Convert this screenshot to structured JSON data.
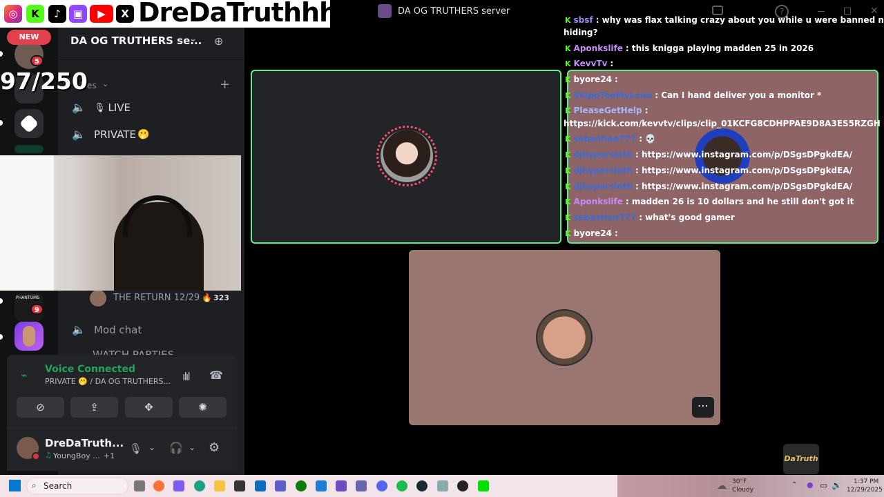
{
  "window": {
    "title": "DA OG TRUTHERS server"
  },
  "overlay": {
    "handle": "DreDaTruthhh",
    "goal": "97/250",
    "new_label": "NEW"
  },
  "rail": {
    "badges": [
      "5",
      "9"
    ]
  },
  "sidebar": {
    "server_name": "DA OG TRUTHERS se...",
    "category": "ices",
    "channels": {
      "live": "LIVE",
      "private": "PRIVATE",
      "mod_chat": "Mod chat",
      "partial": "WATCH PARTIES"
    },
    "event": {
      "label": "THE RETURN 12/29",
      "count": "323"
    }
  },
  "voice_panel": {
    "status": "Voice Connected",
    "location": "PRIVATE 🫢 / DA OG TRUTHERS..."
  },
  "user_panel": {
    "name": "DreDaTruth...",
    "activity": "YoungBoy ...",
    "plus": "+1"
  },
  "chat": [
    {
      "user": "sbsf",
      "text": "why was flax talking crazy about you while u were banned now he",
      "color": "#9b8afb"
    },
    {
      "user": "",
      "text": "hiding?",
      "color": "#ffffff"
    },
    {
      "user": "Aponkslife",
      "text": "this knigga playing madden 25 in 2026",
      "color": "#c58af9"
    },
    {
      "user": "KevvTv",
      "text": "",
      "color": "#c58af9"
    },
    {
      "user": "byore24",
      "text": "",
      "color": "#ffffff"
    },
    {
      "user": "SkippTooMyLouu",
      "text": "Can I hand deliver you a monitor *",
      "color": "#3b6bd6"
    },
    {
      "user": "PleaseGetHelp",
      "text": "",
      "color": "#a8b8ff"
    },
    {
      "user": "",
      "text": "https://kick.com/kevvtv/clips/clip_01KCFG8CDHPPAE9D8A3ES5RZGH",
      "color": "#ffffff"
    },
    {
      "user": "sebastian777",
      "text": "💀",
      "color": "#3b6bd6"
    },
    {
      "user": "djhypersloth",
      "text": "https://www.instagram.com/p/DSgsDPgkdEA/",
      "color": "#3b6bd6"
    },
    {
      "user": "djhypersloth",
      "text": "https://www.instagram.com/p/DSgsDPgkdEA/",
      "color": "#3b6bd6"
    },
    {
      "user": "djhypersloth",
      "text": "https://www.instagram.com/p/DSgsDPgkdEA/",
      "color": "#3b6bd6"
    },
    {
      "user": "Aponkslife",
      "text": "madden 26 is 10 dollars and he still don't got it",
      "color": "#c58af9"
    },
    {
      "user": "sebastian777",
      "text": "what's good gamer",
      "color": "#3b6bd6"
    },
    {
      "user": "byore24",
      "text": "",
      "color": "#ffffff"
    }
  ],
  "taskbar": {
    "search": "Search",
    "weather_temp": "30°F",
    "weather_desc": "Cloudy",
    "time": "1:37 PM",
    "date": "12/29/2025"
  },
  "watermark": "DaTruth",
  "colors": {
    "voice_green": "#23a55a",
    "tile_border": "#57f287",
    "kick_green": "#53fc18"
  }
}
